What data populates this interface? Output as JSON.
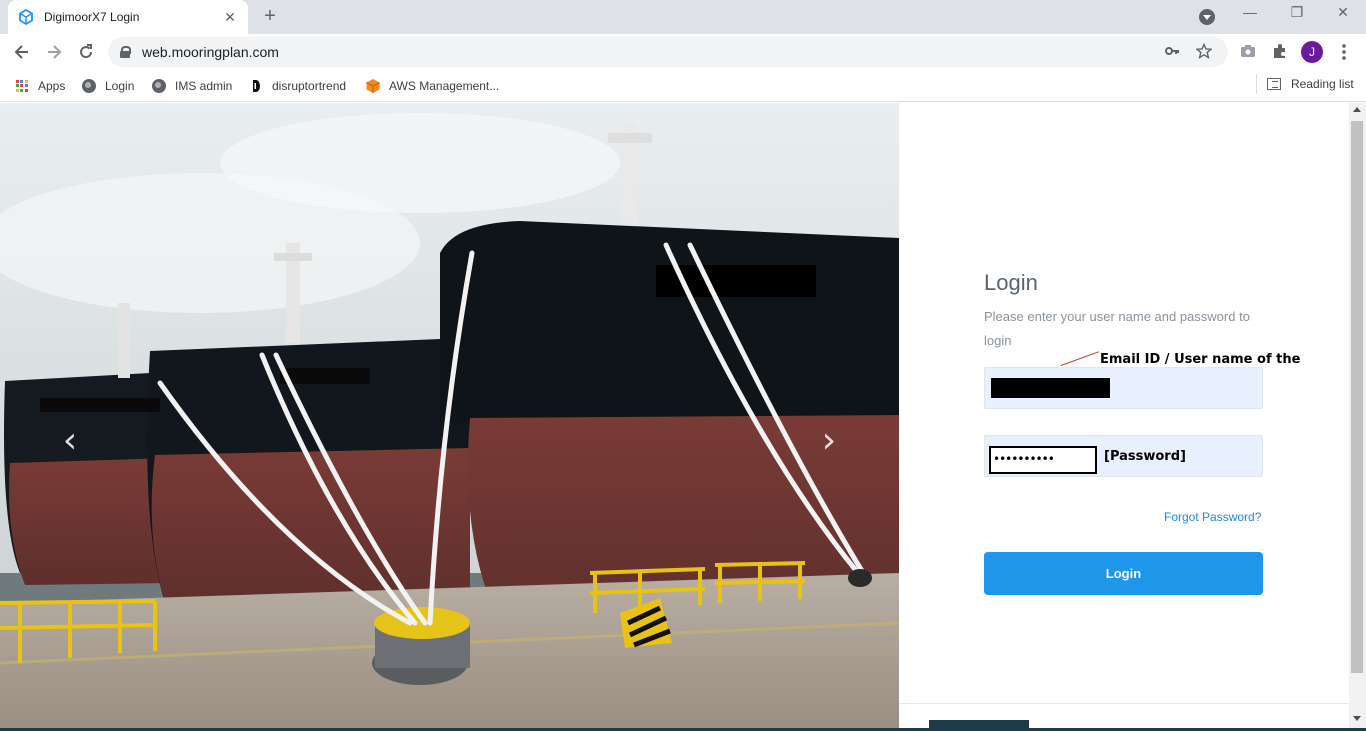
{
  "browser": {
    "tab_title": "DigimoorX7 Login",
    "tab_close": "✕",
    "new_tab": "+",
    "url": "web.mooringplan.com",
    "avatar_letter": "J",
    "window_controls": {
      "minimize": "—",
      "restore": "❐",
      "close": "✕"
    },
    "bookmarks": [
      {
        "label": "Apps",
        "icon": "apps-grid-icon"
      },
      {
        "label": "Login",
        "icon": "globe-icon"
      },
      {
        "label": "IMS admin",
        "icon": "globe-icon"
      },
      {
        "label": "disruptortrend",
        "icon": "d-logo-icon"
      },
      {
        "label": "AWS Management...",
        "icon": "aws-cube-icon"
      }
    ],
    "reading_list": "Reading list",
    "accent_color": "#1a73e8"
  },
  "login": {
    "title": "Login",
    "description": "Please enter your user name and password to login",
    "email_annotation": "Email ID / User name of the Vessel",
    "password_mask": "••••••••••",
    "password_annotation": "[Password]",
    "forgot_password": "Forgot Password?",
    "button_label": "Login",
    "button_color": "#1e96ea"
  },
  "hero": {
    "prev_arrow": "‹",
    "next_arrow": "›",
    "image_subject": "moored-ships-photo"
  }
}
